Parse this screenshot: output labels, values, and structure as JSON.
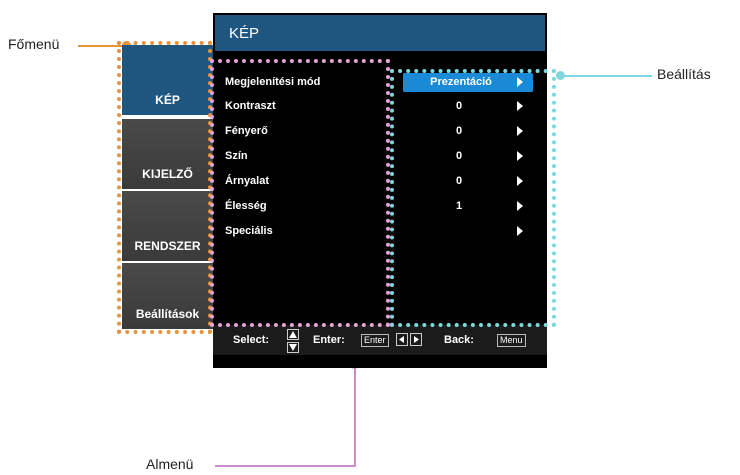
{
  "callouts": {
    "fomenu": "Főmenü",
    "beallitas": "Beállítás",
    "almenu": "Almenü"
  },
  "colors": {
    "fomenu_marker": "#e8923a",
    "beallitas_marker": "#7fd6dc",
    "almenu_marker": "#c98ec8"
  },
  "tabs": [
    {
      "label": "KÉP",
      "active": true
    },
    {
      "label": "KIJELZŐ",
      "active": false
    },
    {
      "label": "RENDSZER",
      "active": false
    },
    {
      "label": "Beállítások",
      "active": false
    }
  ],
  "panel": {
    "title": "KÉP",
    "items": [
      {
        "label": "Megjelenítési mód",
        "value": "Prezentáció",
        "selected": true
      },
      {
        "label": "Kontraszt",
        "value": "0",
        "selected": false
      },
      {
        "label": "Fényerő",
        "value": "0",
        "selected": false
      },
      {
        "label": "Szín",
        "value": "0",
        "selected": false
      },
      {
        "label": "Árnyalat",
        "value": "0",
        "selected": false
      },
      {
        "label": "Élesség",
        "value": "1",
        "selected": false
      },
      {
        "label": "Speciális",
        "value": "",
        "selected": false
      }
    ]
  },
  "footer": {
    "select": "Select:",
    "enter": "Enter:",
    "enter_key": "Enter",
    "back": "Back:",
    "back_key": "Menu"
  }
}
